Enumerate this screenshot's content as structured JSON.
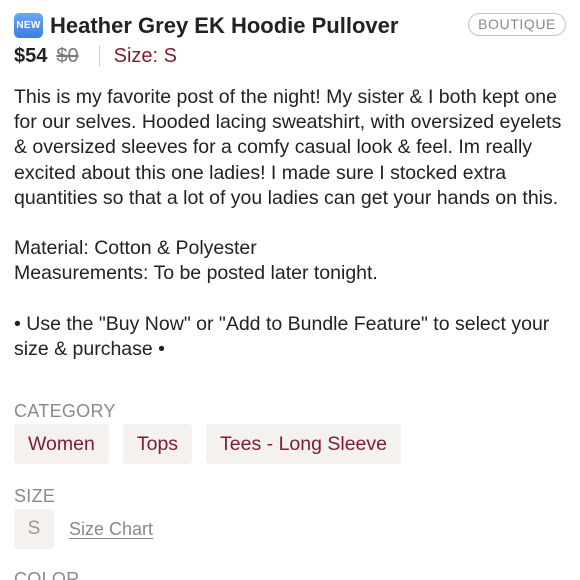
{
  "listing": {
    "badge": "NEW",
    "title": "Heather Grey EK Hoodie Pullover",
    "store_tag": "BOUTIQUE",
    "price": "$54",
    "original_price": "$0",
    "size_text": "Size: S",
    "description": "This is my favorite post of the night! My sister & I both kept one for our selves. Hooded lacing sweatshirt, with oversized eyelets & oversized sleeves for a comfy casual look & feel. Im really excited about this one ladies! I made sure I stocked extra quantities so that a lot of you ladies can get your hands on this.\n\nMaterial: Cotton & Polyester\nMeasurements: To be posted later tonight.\n\n• Use the \"Buy Now\" or \"Add to Bundle Feature\" to select your size & purchase •"
  },
  "category": {
    "label": "CATEGORY",
    "items": [
      "Women",
      "Tops",
      "Tees - Long Sleeve"
    ]
  },
  "size": {
    "label": "SIZE",
    "value": "S",
    "chart_link": "Size Chart"
  },
  "color": {
    "label": "COLOR"
  },
  "colors": {
    "accent": "#7f1d2d",
    "chip_bg": "#f4f1ef",
    "muted": "#8a8a8a",
    "badge_blue": "#3d7fe0"
  }
}
